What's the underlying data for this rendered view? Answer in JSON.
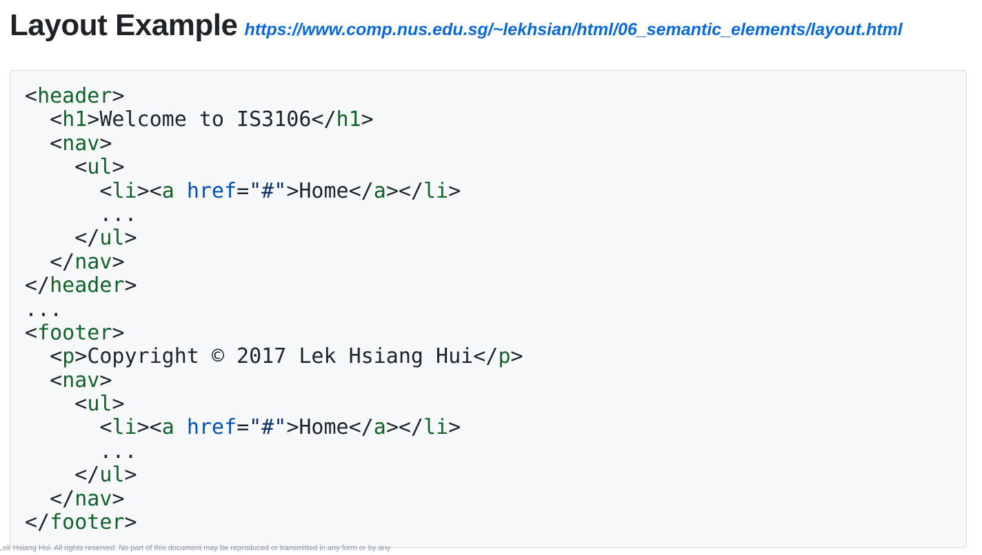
{
  "header": {
    "title": "Layout Example",
    "link_text": "https://www.comp.nus.edu.sg/~lekhsian/html/06_semantic_elements/layout.html"
  },
  "code": {
    "language": "html",
    "lines": [
      [
        {
          "t": "punct",
          "v": "<"
        },
        {
          "t": "tag",
          "v": "header"
        },
        {
          "t": "punct",
          "v": ">"
        }
      ],
      [
        {
          "t": "punct",
          "v": "  <"
        },
        {
          "t": "tag",
          "v": "h1"
        },
        {
          "t": "punct",
          "v": ">"
        },
        {
          "t": "text",
          "v": "Welcome to IS3106"
        },
        {
          "t": "punct",
          "v": "</"
        },
        {
          "t": "tag",
          "v": "h1"
        },
        {
          "t": "punct",
          "v": ">"
        }
      ],
      [
        {
          "t": "punct",
          "v": "  <"
        },
        {
          "t": "tag",
          "v": "nav"
        },
        {
          "t": "punct",
          "v": ">"
        }
      ],
      [
        {
          "t": "punct",
          "v": "    <"
        },
        {
          "t": "tag",
          "v": "ul"
        },
        {
          "t": "punct",
          "v": ">"
        }
      ],
      [
        {
          "t": "punct",
          "v": "      <"
        },
        {
          "t": "tag",
          "v": "li"
        },
        {
          "t": "punct",
          "v": "><"
        },
        {
          "t": "tag",
          "v": "a"
        },
        {
          "t": "punct",
          "v": " "
        },
        {
          "t": "attr",
          "v": "href"
        },
        {
          "t": "punct",
          "v": "="
        },
        {
          "t": "str",
          "v": "\"#\""
        },
        {
          "t": "punct",
          "v": ">"
        },
        {
          "t": "text",
          "v": "Home"
        },
        {
          "t": "punct",
          "v": "</"
        },
        {
          "t": "tag",
          "v": "a"
        },
        {
          "t": "punct",
          "v": "></"
        },
        {
          "t": "tag",
          "v": "li"
        },
        {
          "t": "punct",
          "v": ">"
        }
      ],
      [
        {
          "t": "text",
          "v": "      ..."
        }
      ],
      [
        {
          "t": "punct",
          "v": "    </"
        },
        {
          "t": "tag",
          "v": "ul"
        },
        {
          "t": "punct",
          "v": ">"
        }
      ],
      [
        {
          "t": "punct",
          "v": "  </"
        },
        {
          "t": "tag",
          "v": "nav"
        },
        {
          "t": "punct",
          "v": ">"
        }
      ],
      [
        {
          "t": "punct",
          "v": "</"
        },
        {
          "t": "tag",
          "v": "header"
        },
        {
          "t": "punct",
          "v": ">"
        }
      ],
      [
        {
          "t": "text",
          "v": "..."
        }
      ],
      [
        {
          "t": "punct",
          "v": "<"
        },
        {
          "t": "tag",
          "v": "footer"
        },
        {
          "t": "punct",
          "v": ">"
        }
      ],
      [
        {
          "t": "punct",
          "v": "  <"
        },
        {
          "t": "tag",
          "v": "p"
        },
        {
          "t": "punct",
          "v": ">"
        },
        {
          "t": "text",
          "v": "Copyright © 2017 Lek Hsiang Hui"
        },
        {
          "t": "punct",
          "v": "</"
        },
        {
          "t": "tag",
          "v": "p"
        },
        {
          "t": "punct",
          "v": ">"
        }
      ],
      [
        {
          "t": "punct",
          "v": "  <"
        },
        {
          "t": "tag",
          "v": "nav"
        },
        {
          "t": "punct",
          "v": ">"
        }
      ],
      [
        {
          "t": "punct",
          "v": "    <"
        },
        {
          "t": "tag",
          "v": "ul"
        },
        {
          "t": "punct",
          "v": ">"
        }
      ],
      [
        {
          "t": "punct",
          "v": "      <"
        },
        {
          "t": "tag",
          "v": "li"
        },
        {
          "t": "punct",
          "v": "><"
        },
        {
          "t": "tag",
          "v": "a"
        },
        {
          "t": "punct",
          "v": " "
        },
        {
          "t": "attr",
          "v": "href"
        },
        {
          "t": "punct",
          "v": "="
        },
        {
          "t": "str",
          "v": "\"#\""
        },
        {
          "t": "punct",
          "v": ">"
        },
        {
          "t": "text",
          "v": "Home"
        },
        {
          "t": "punct",
          "v": "</"
        },
        {
          "t": "tag",
          "v": "a"
        },
        {
          "t": "punct",
          "v": "></"
        },
        {
          "t": "tag",
          "v": "li"
        },
        {
          "t": "punct",
          "v": ">"
        }
      ],
      [
        {
          "t": "text",
          "v": "      ..."
        }
      ],
      [
        {
          "t": "punct",
          "v": "    </"
        },
        {
          "t": "tag",
          "v": "ul"
        },
        {
          "t": "punct",
          "v": ">"
        }
      ],
      [
        {
          "t": "punct",
          "v": "  </"
        },
        {
          "t": "tag",
          "v": "nav"
        },
        {
          "t": "punct",
          "v": ">"
        }
      ],
      [
        {
          "t": "punct",
          "v": "</"
        },
        {
          "t": "tag",
          "v": "footer"
        },
        {
          "t": "punct",
          "v": ">"
        }
      ]
    ]
  },
  "footer": {
    "note": "Lek Hsiang Hui. All rights reserved. No part of this document may be reproduced or transmitted in any form or by any"
  },
  "colors": {
    "tag": "#116329",
    "attr": "#0550ae",
    "string": "#0a3069",
    "text": "#1f2328",
    "link": "#0969da",
    "code_background": "#f6f8fa"
  }
}
